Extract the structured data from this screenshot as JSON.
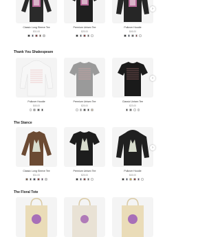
{
  "sections": [
    {
      "title": "",
      "products": [
        {
          "name": "Classic Long Sleeve Tee",
          "price": "$31.00",
          "swatches": [
            "#222222",
            "#2d3b55",
            "#7a2b2b",
            "#5b3a29",
            "#cccccc"
          ]
        },
        {
          "name": "Premium Unisex Tee",
          "price": "$25.00",
          "swatches": [
            "#222222",
            "#2d3b55",
            "#7a2b2b",
            "#4a4a4a",
            "#ffffff"
          ]
        },
        {
          "name": "Pullover Hoodie",
          "price": "$45.00",
          "swatches": [
            "#222222",
            "#2d3b55",
            "#555555",
            "#7a2b2b",
            "#ffffff"
          ]
        }
      ]
    },
    {
      "title": "Thank You Shakespeare",
      "products": [
        {
          "name": "Pullover Hoodie",
          "price": "$45.00",
          "swatches": [
            "#ffffff",
            "#999999",
            "#444444",
            "#222222"
          ]
        },
        {
          "name": "Premium Unisex Tee",
          "price": "$25.00",
          "swatches": [
            "#ffffff",
            "#999999",
            "#444444",
            "#222222",
            "#c9b8a0"
          ]
        },
        {
          "name": "Classic Unisex Tee",
          "price": "$23.00",
          "swatches": [
            "#222222",
            "#666666",
            "#ffffff",
            "#dddddd"
          ]
        }
      ]
    },
    {
      "title": "The Stance",
      "products": [
        {
          "name": "Classic Long Sleeve Tee",
          "price": "$31.00",
          "swatches": [
            "#6b4a33",
            "#222222",
            "#2d3b55",
            "#7a2b2b",
            "#4b2f5e",
            "#cccccc"
          ]
        },
        {
          "name": "Premium Unisex Tee",
          "price": "$25.00",
          "swatches": [
            "#222222",
            "#2d3b55",
            "#7a2b2b",
            "#4a4a4a",
            "#ffffff"
          ]
        },
        {
          "name": "Pullover Hoodie",
          "price": "$45.00",
          "swatches": [
            "#222222",
            "#2d3b55",
            "#c8a43a",
            "#7a2b2b",
            "#4b2f5e",
            "#ffffff"
          ]
        }
      ]
    },
    {
      "title": "The Floral Tote",
      "products": []
    }
  ],
  "icons": {
    "next": "chevron-right-icon"
  },
  "colors": {
    "accent": "#7b4fa0",
    "text": "#222222",
    "muted": "#888888"
  }
}
